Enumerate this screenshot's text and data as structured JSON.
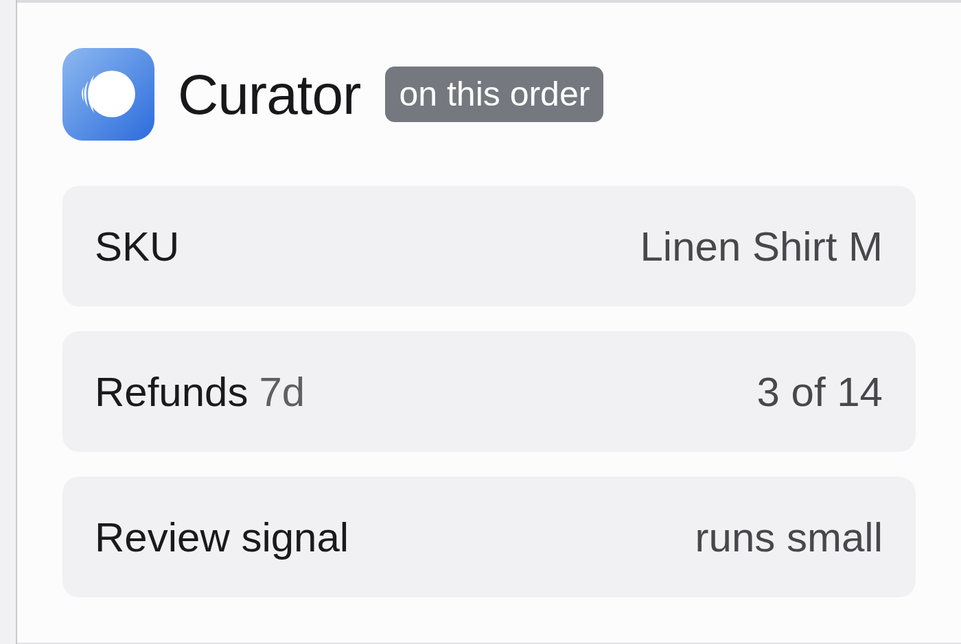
{
  "app": {
    "name": "Curator",
    "badge": "on this order"
  },
  "rows": [
    {
      "label": "SKU",
      "value": "Linen Shirt M"
    },
    {
      "label": "Refunds",
      "qualifier": "7d",
      "value": "3 of 14"
    },
    {
      "label": "Review signal",
      "value": "runs small"
    }
  ]
}
